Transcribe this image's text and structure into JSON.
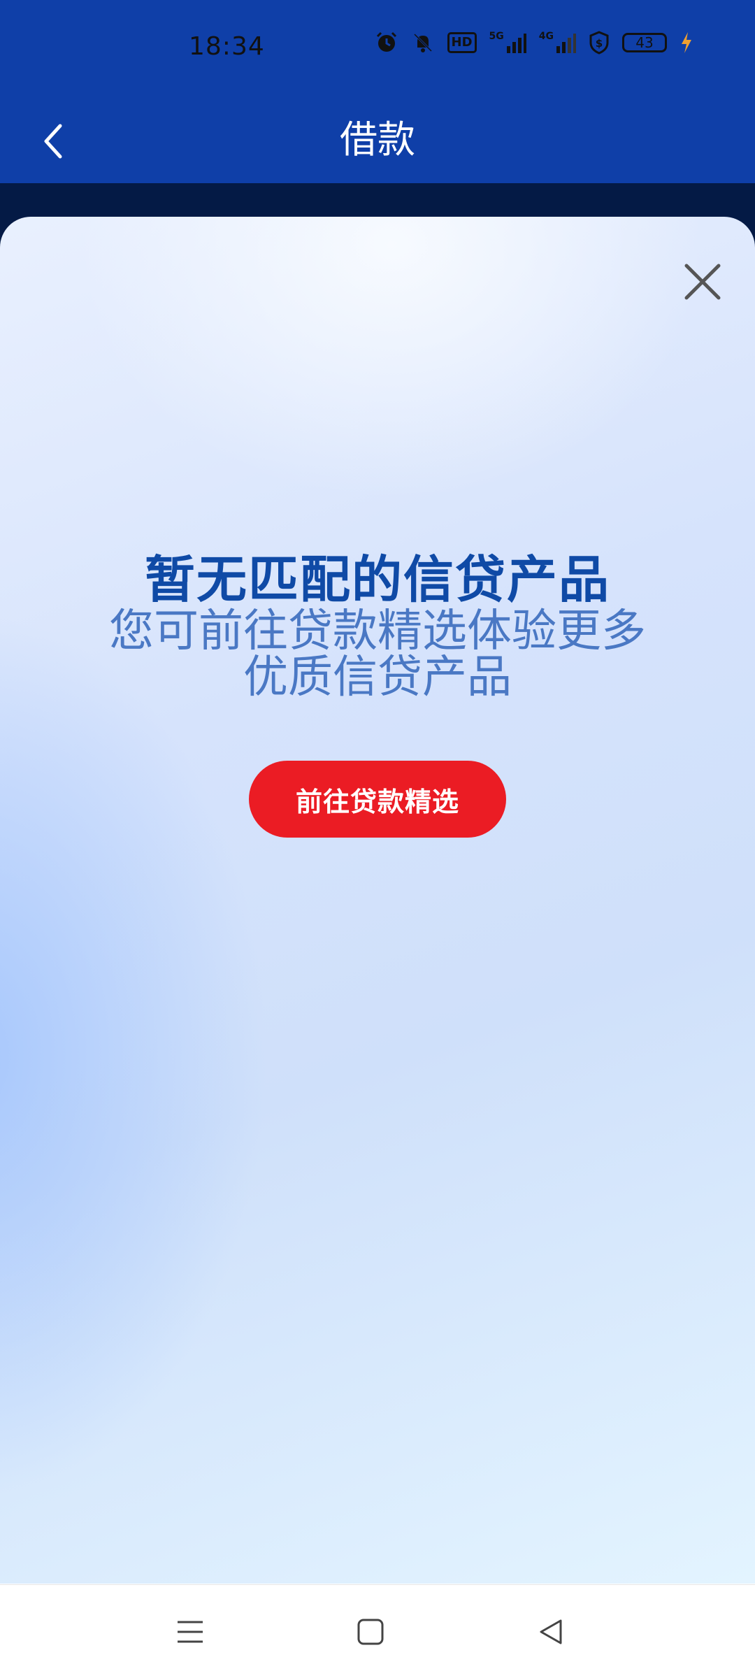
{
  "status_bar": {
    "time": "18:34",
    "hd_label": "HD",
    "net1_label": "5G",
    "net2_label": "4G",
    "battery_level": "43",
    "icons": [
      "alarm-icon",
      "mute-bell-icon",
      "hd-icon",
      "signal-5g-icon",
      "signal-4g-icon",
      "shield-dollar-icon",
      "battery-icon",
      "charging-icon"
    ]
  },
  "header": {
    "title": "借款",
    "back_icon": "chevron-left-icon"
  },
  "modal": {
    "close_icon": "close-icon",
    "title": "暂无匹配的信贷产品",
    "subtitle": "您可前往贷款精选体验更多优质信贷产品",
    "cta_label": "前往贷款精选"
  },
  "nav_bar": {
    "icons": [
      "menu-icon",
      "home-square-icon",
      "back-triangle-icon"
    ]
  },
  "colors": {
    "header_bg": "#0f3fa8",
    "title_blue": "#0f4aa6",
    "subtitle_blue": "#4a78c4",
    "cta_red": "#eb1c24"
  }
}
